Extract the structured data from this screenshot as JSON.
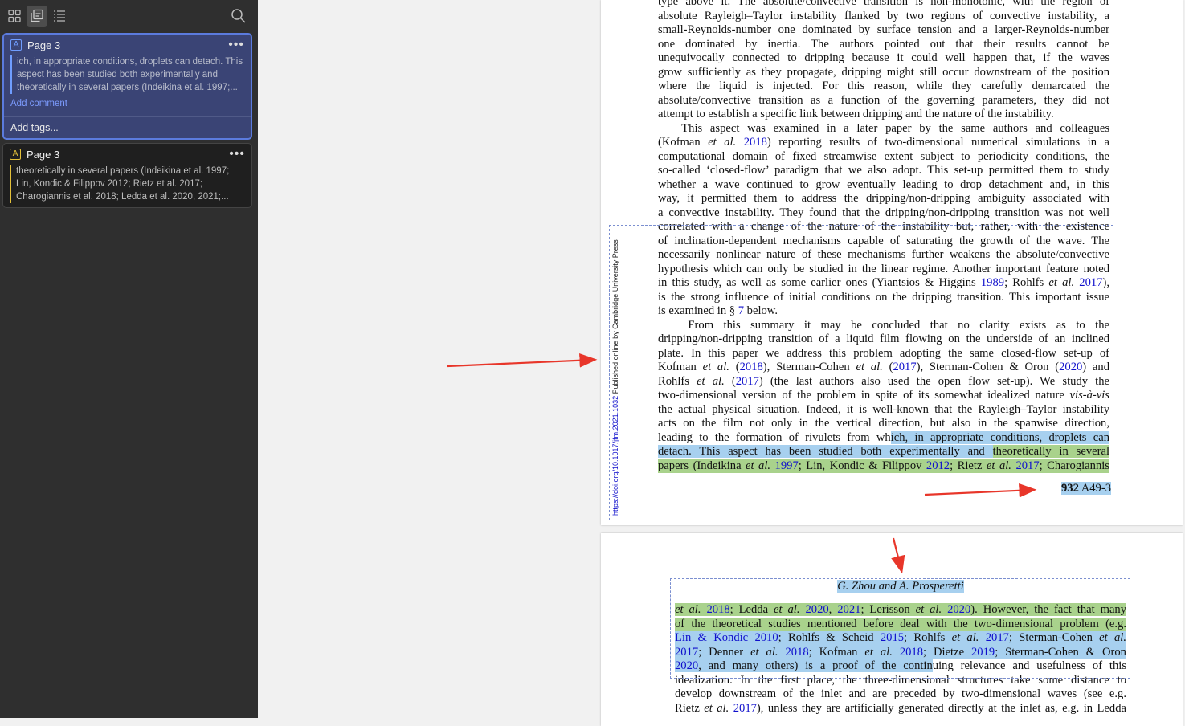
{
  "toolbar": {
    "icons": [
      "grid-icon",
      "annotations-icon",
      "outline-icon",
      "search-icon"
    ]
  },
  "annotations": [
    {
      "page_label": "Page 3",
      "color": "#6f9dff",
      "snippet": "ich, in appropriate conditions, droplets can detach. This aspect has been studied both experimentally and theoretically in several papers (Indeikina et al. 1997;...",
      "add_comment": "Add comment",
      "add_tags": "Add tags...",
      "more": "•••"
    },
    {
      "page_label": "Page 3",
      "color": "#e4c13a",
      "snippet": "theoretically in several papers (Indeikina et al. 1997; Lin, Kondic & Filippov 2012; Rietz et al. 2017; Charogiannis et al. 2018; Ledda et al. 2020, 2021;...",
      "more": "•••"
    }
  ],
  "page1": {
    "side_note": "Published online by Cambridge University Press",
    "side_doi": "https://doi.org/10.1017/jfm.2021.1032",
    "page_num": "932",
    "page_id": "A49-3"
  },
  "page2": {
    "header": "G. Zhou and A. Prosperetti"
  }
}
